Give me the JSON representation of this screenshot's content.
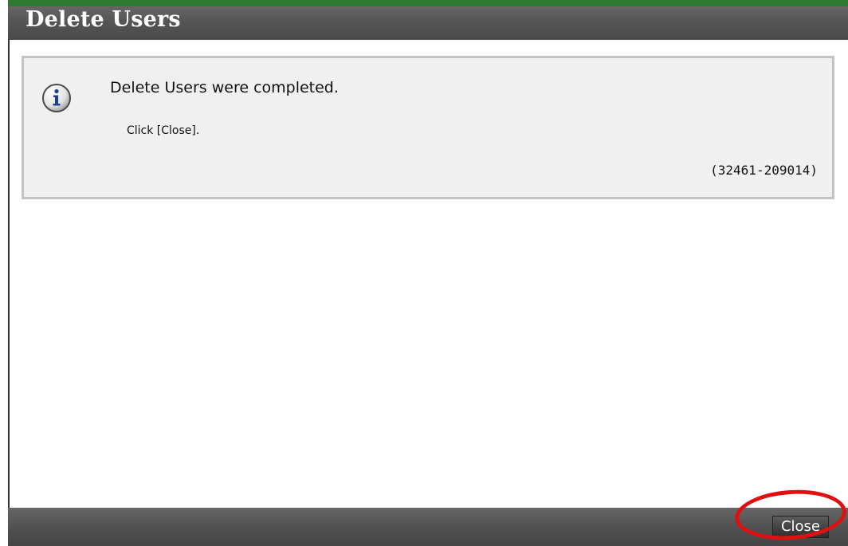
{
  "dialog": {
    "title": "Delete Users"
  },
  "message": {
    "icon": "info-icon",
    "main_text": "Delete Users were completed.",
    "sub_text": "Click [Close].",
    "code": "(32461-209014)"
  },
  "footer": {
    "close_label": "Close"
  },
  "colors": {
    "title_bar": "#555555",
    "accent_strip": "#2f7a2f",
    "message_bg": "#f0f0f0",
    "highlight": "#e01010"
  }
}
